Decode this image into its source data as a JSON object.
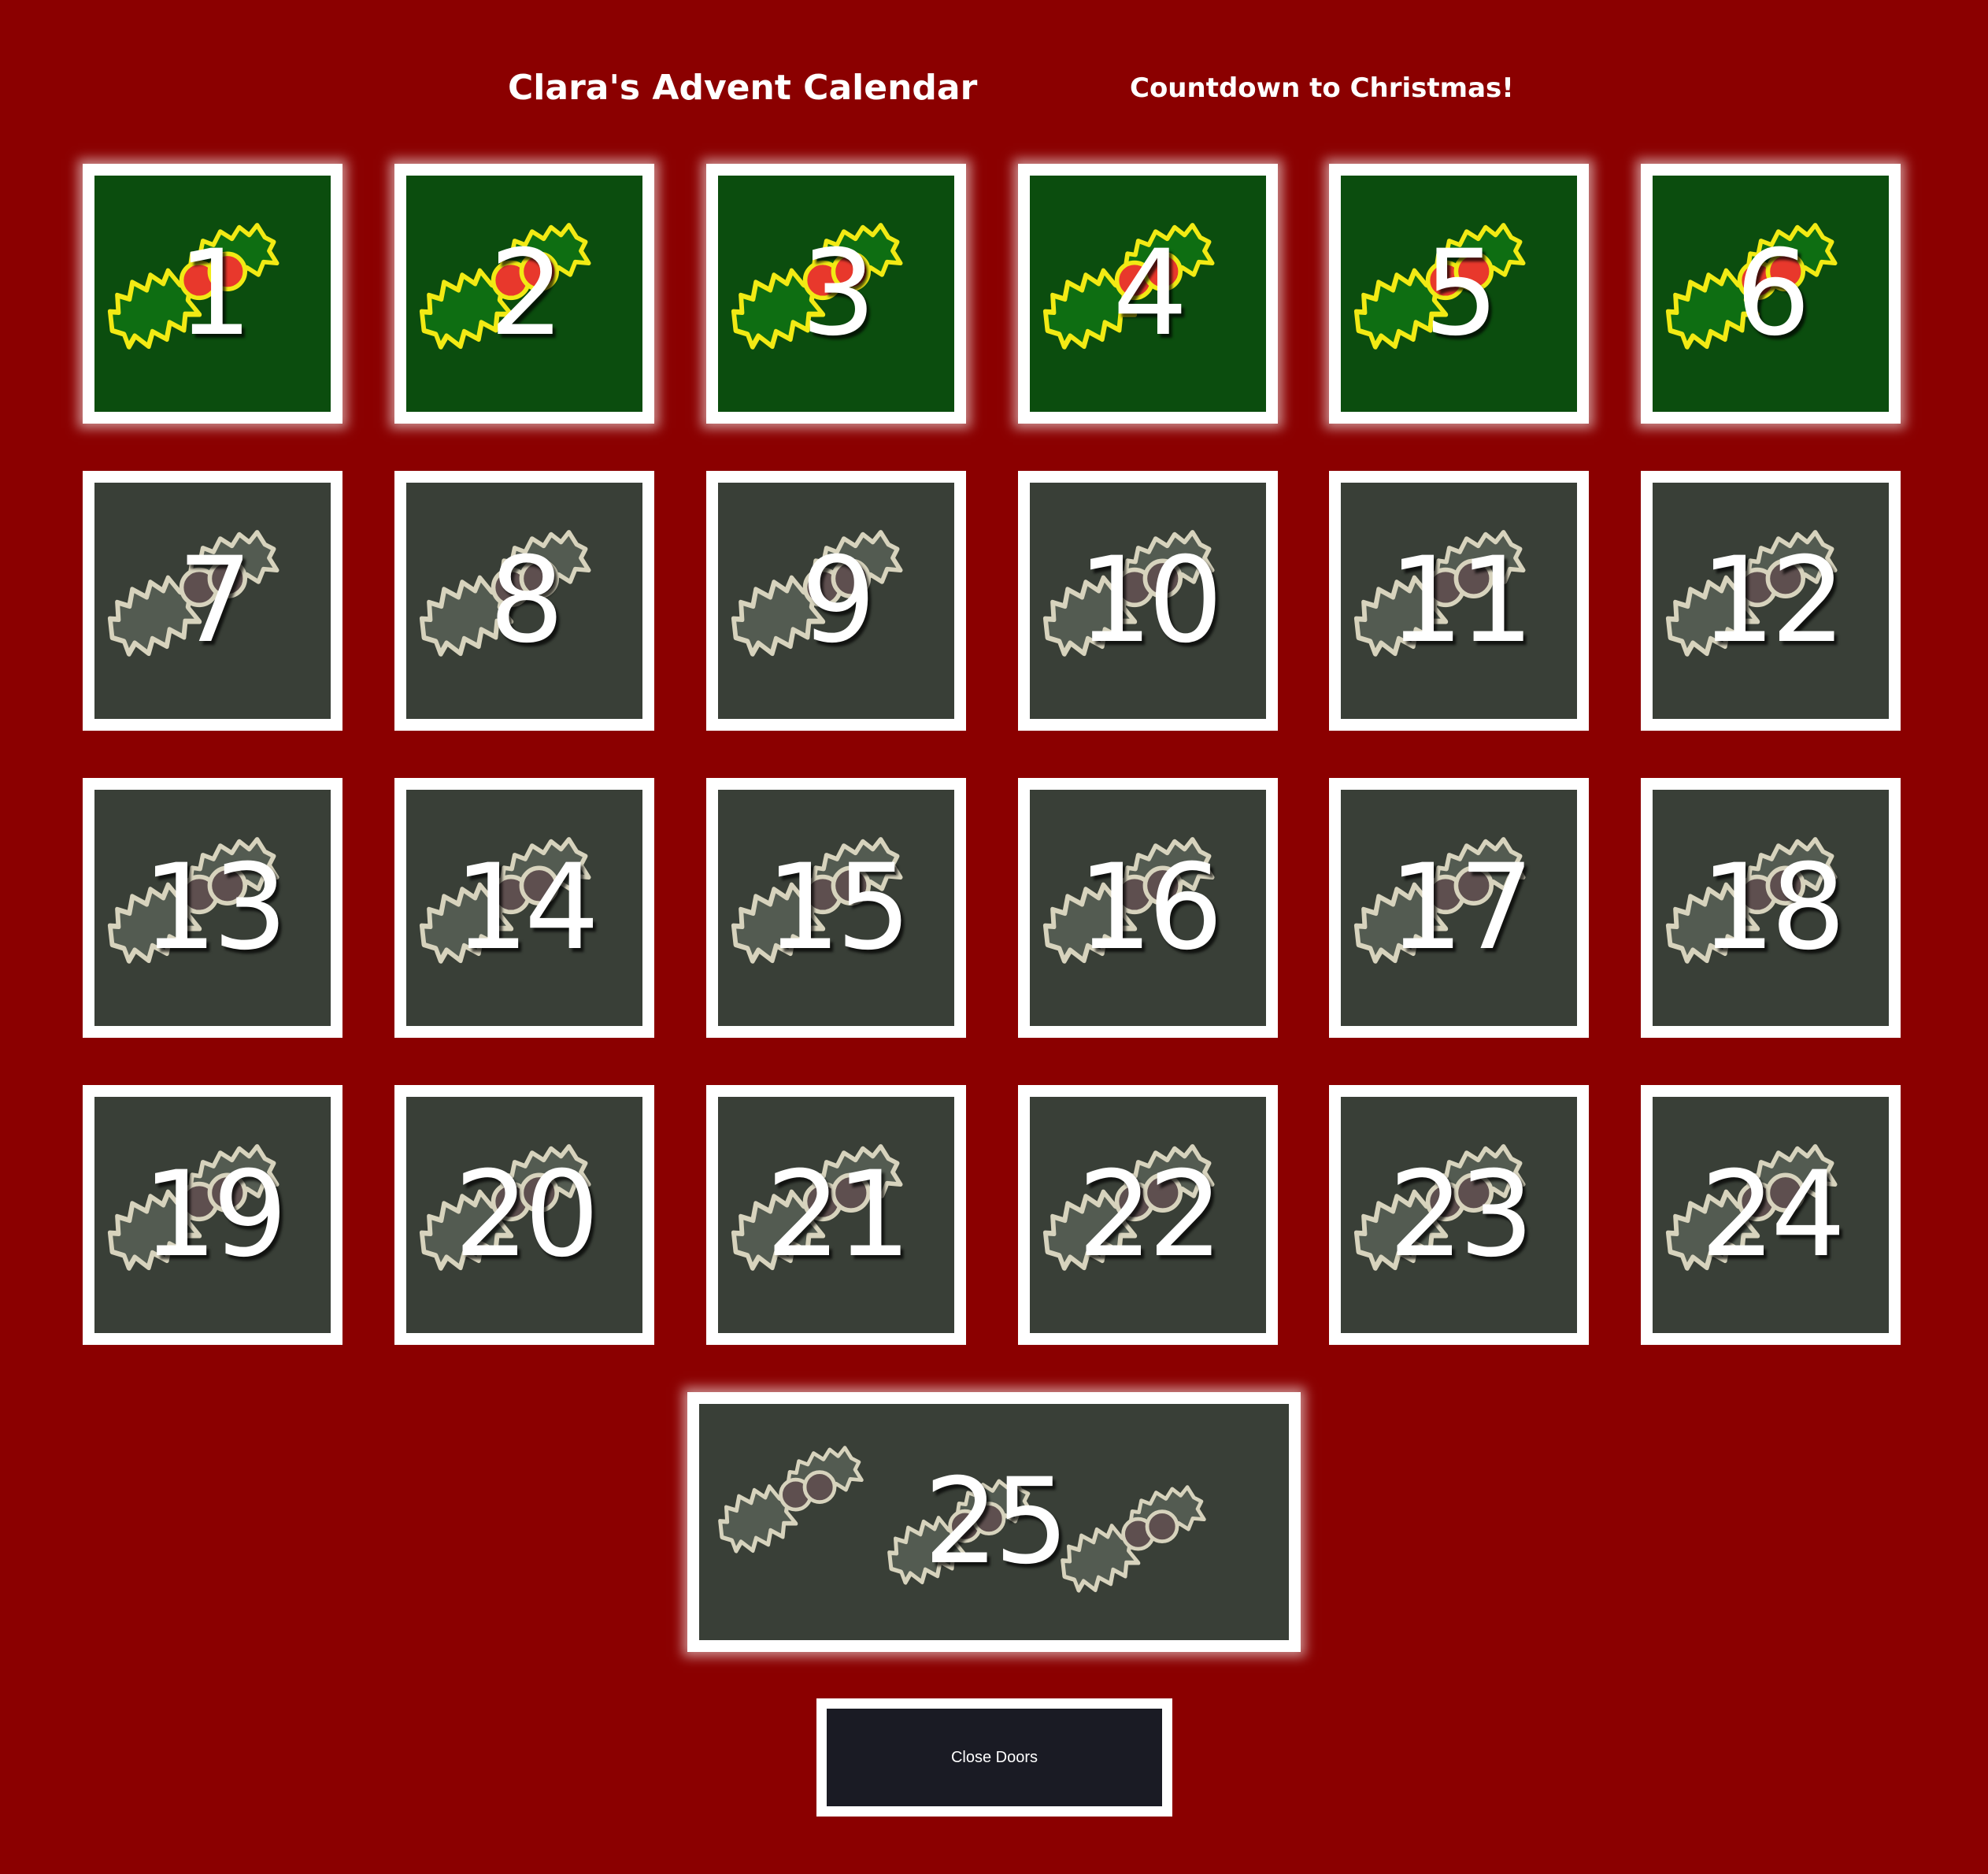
{
  "header": {
    "title": "Clara's Advent Calendar",
    "subtitle": "Countdown to Christmas!"
  },
  "doors": [
    {
      "label": "1",
      "state": "open"
    },
    {
      "label": "2",
      "state": "open"
    },
    {
      "label": "3",
      "state": "open"
    },
    {
      "label": "4",
      "state": "open"
    },
    {
      "label": "5",
      "state": "open"
    },
    {
      "label": "6",
      "state": "open"
    },
    {
      "label": "7",
      "state": "closed"
    },
    {
      "label": "8",
      "state": "closed"
    },
    {
      "label": "9",
      "state": "closed"
    },
    {
      "label": "10",
      "state": "closed"
    },
    {
      "label": "11",
      "state": "closed"
    },
    {
      "label": "12",
      "state": "closed"
    },
    {
      "label": "13",
      "state": "closed"
    },
    {
      "label": "14",
      "state": "closed"
    },
    {
      "label": "15",
      "state": "closed"
    },
    {
      "label": "16",
      "state": "closed"
    },
    {
      "label": "17",
      "state": "closed"
    },
    {
      "label": "18",
      "state": "closed"
    },
    {
      "label": "19",
      "state": "closed"
    },
    {
      "label": "20",
      "state": "closed"
    },
    {
      "label": "21",
      "state": "closed"
    },
    {
      "label": "22",
      "state": "closed"
    },
    {
      "label": "23",
      "state": "closed"
    },
    {
      "label": "24",
      "state": "closed"
    },
    {
      "label": "25",
      "state": "closed"
    }
  ],
  "controls": {
    "close_doors_label": "Close Doors"
  },
  "colors": {
    "background": "#8b0000",
    "door_open": "#0b4d0e",
    "door_closed": "#393f37",
    "holly_open_leaf": "#0e6e12",
    "holly_open_outline": "#f2ea14",
    "holly_open_berry": "#e8382c",
    "holly_closed_leaf": "#535b51",
    "holly_closed_outline": "#d7d3bd",
    "holly_closed_berry": "#5e4f4f",
    "button_bg": "#1a1b24"
  }
}
